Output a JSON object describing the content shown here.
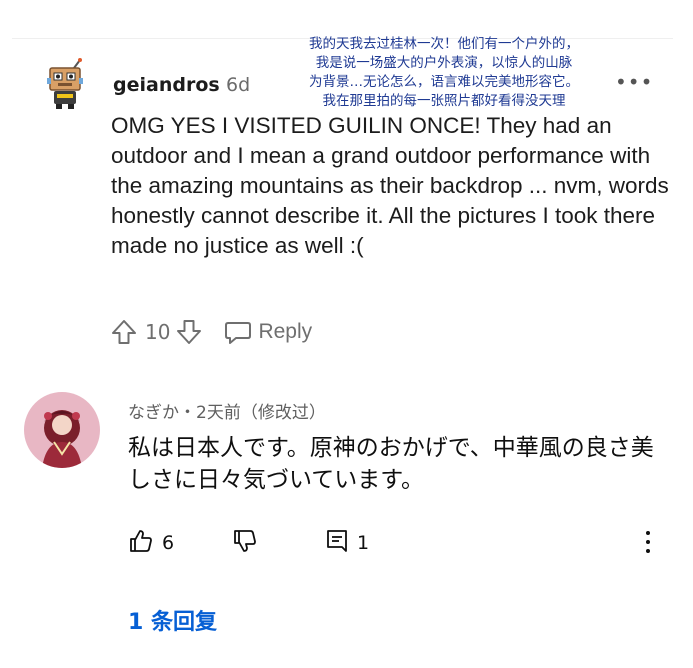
{
  "reddit_comment": {
    "username": "geiandros",
    "age": "6d",
    "translation_lines": [
      "我的天我去过桂林一次！他们有一个户外的，",
      "我是说一场盛大的户外表演，以惊人的山脉",
      "为背景…无论怎么，语言难以完美地形容它。",
      "我在那里拍的每一张照片都好看得没天理"
    ],
    "overflow_label": "•••",
    "body": "OMG YES I VISITED GUILIN ONCE! They had an outdoor and I mean a grand outdoor performance with the amazing mountains as their backdrop ... nvm, words honestly cannot describe it. All the pictures I took there made no justice as well :(",
    "vote_count": "10",
    "reply_label": "Reply",
    "icons": [
      "upvote-icon",
      "downvote-icon",
      "chat-bubble-icon",
      "robot-avatar-icon"
    ]
  },
  "youtube_comment": {
    "meta": "なぎか・2天前（修改过）",
    "text": "私は日本人です。原神のおかげで、中華風の良さ美しさに日々気づいています。",
    "like_count": "6",
    "reply_count": "1",
    "replies_link": "1 条回复",
    "icons": [
      "thumb-up-icon",
      "thumb-down-icon",
      "comment-icon",
      "more-vert-icon"
    ],
    "accent_color": "#065fd4"
  }
}
